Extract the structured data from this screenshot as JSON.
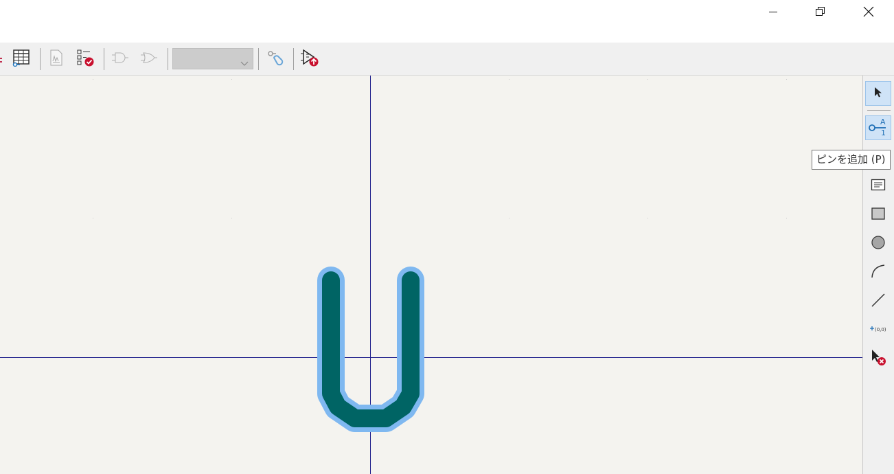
{
  "window_controls": {
    "minimize_icon": "minimize-icon",
    "restore_icon": "restore-icon",
    "close_icon": "close-icon"
  },
  "toolbar": {
    "buttons": [
      {
        "icon": "pin-table-icon"
      },
      {
        "icon": "datasheet-icon"
      },
      {
        "icon": "symbol-checker-icon"
      },
      {
        "icon": "unit-previous-icon"
      },
      {
        "icon": "unit-next-icon"
      },
      {
        "icon": "pin-link-icon"
      },
      {
        "icon": "sim-model-icon"
      }
    ],
    "unit_combo": {
      "value": ""
    }
  },
  "right_toolbar": {
    "tools": [
      {
        "icon": "select-cursor-icon",
        "active": true
      },
      {
        "icon": "add-pin-icon",
        "active": true
      },
      {
        "icon": "add-textbox-icon"
      },
      {
        "icon": "add-rectangle-icon"
      },
      {
        "icon": "add-circle-icon"
      },
      {
        "icon": "add-arc-icon"
      },
      {
        "icon": "add-line-icon"
      },
      {
        "icon": "anchor-origin-icon"
      },
      {
        "icon": "delete-tool-icon"
      }
    ]
  },
  "tooltip": {
    "text": "ピンを追加  (P)"
  },
  "colors": {
    "canvas_bg": "#f4f3ef",
    "axis": "#1c1c8a",
    "shape_fill": "#006464",
    "shape_outline": "#7fb8f0",
    "active_tool": "#cfe3f7"
  }
}
